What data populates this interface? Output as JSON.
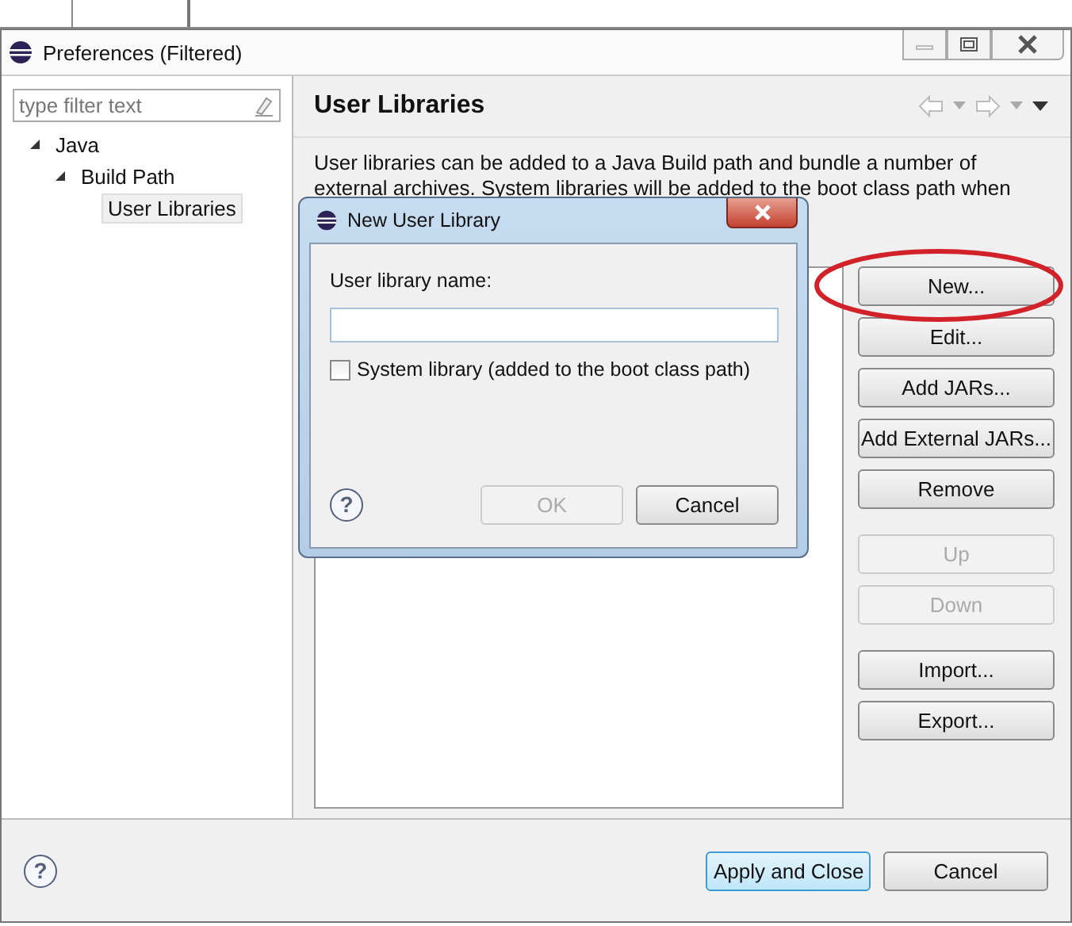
{
  "window": {
    "title": "Preferences (Filtered)"
  },
  "filter": {
    "placeholder": "type filter text"
  },
  "tree": [
    {
      "label": "Java",
      "expanded": true,
      "selected": false,
      "children": [
        {
          "label": "Build Path",
          "expanded": true,
          "selected": false,
          "children": [
            {
              "label": "User Libraries",
              "selected": true
            }
          ]
        }
      ]
    }
  ],
  "page": {
    "title": "User Libraries",
    "description": [
      "User libraries can be added to a Java Build path and bundle a number of",
      "external archives. System libraries will be added to the boot class path when"
    ]
  },
  "library_buttons": [
    {
      "label": "New...",
      "disabled": false,
      "highlighted": true
    },
    {
      "label": "Edit...",
      "disabled": false,
      "highlighted": false
    },
    {
      "label": "Add JARs...",
      "disabled": false,
      "highlighted": false
    },
    {
      "label": "Add External JARs...",
      "disabled": false,
      "highlighted": false
    },
    {
      "label": "Remove",
      "disabled": false,
      "highlighted": false
    },
    {
      "label": "Up",
      "disabled": true,
      "highlighted": false
    },
    {
      "label": "Down",
      "disabled": true,
      "highlighted": false
    },
    {
      "label": "Import...",
      "disabled": false,
      "highlighted": false
    },
    {
      "label": "Export...",
      "disabled": false,
      "highlighted": false
    }
  ],
  "footer_help": "?",
  "footer_buttons": [
    {
      "label": "Apply and Close",
      "default": true
    },
    {
      "label": "Cancel",
      "default": false
    }
  ],
  "dialog": {
    "title": "New User Library",
    "name_label": "User library name:",
    "system_library": {
      "label": "System library (added to the boot class path)",
      "checked": false
    },
    "help": "?",
    "buttons": [
      {
        "label": "OK",
        "disabled": true
      },
      {
        "label": "Cancel",
        "disabled": false
      }
    ]
  }
}
